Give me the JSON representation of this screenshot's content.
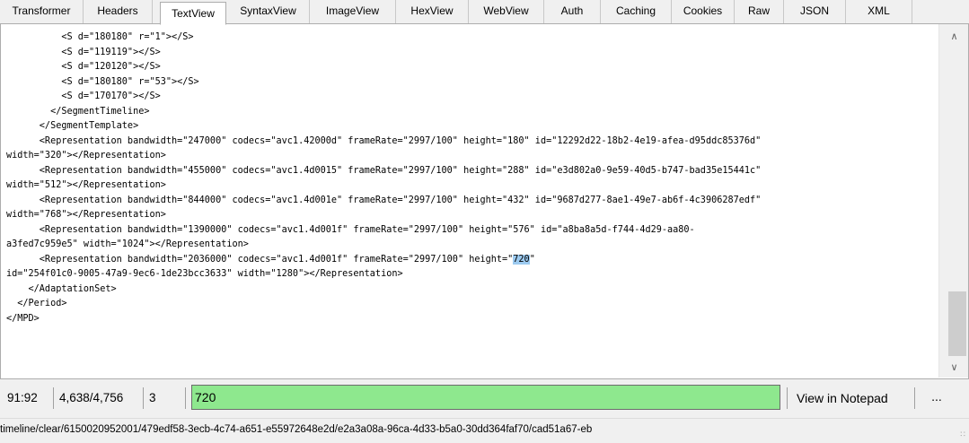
{
  "tabs": [
    {
      "label": "Transformer",
      "active": false
    },
    {
      "label": "Headers",
      "active": false
    },
    {
      "label": "TextView",
      "active": true
    },
    {
      "label": "SyntaxView",
      "active": false
    },
    {
      "label": "ImageView",
      "active": false
    },
    {
      "label": "HexView",
      "active": false
    },
    {
      "label": "WebView",
      "active": false
    },
    {
      "label": "Auth",
      "active": false
    },
    {
      "label": "Caching",
      "active": false
    },
    {
      "label": "Cookies",
      "active": false
    },
    {
      "label": "Raw",
      "active": false
    },
    {
      "label": "JSON",
      "active": false
    },
    {
      "label": "XML",
      "active": false
    }
  ],
  "text_lines": [
    "          <S d=\"180180\" r=\"1\"></S>",
    "          <S d=\"119119\"></S>",
    "          <S d=\"120120\"></S>",
    "          <S d=\"180180\" r=\"53\"></S>",
    "          <S d=\"170170\"></S>",
    "        </SegmentTimeline>",
    "      </SegmentTemplate>",
    "      <Representation bandwidth=\"247000\" codecs=\"avc1.42000d\" frameRate=\"2997/100\" height=\"180\" id=\"12292d22-18b2-4e19-afea-d95ddc85376d\"",
    "width=\"320\"></Representation>",
    "      <Representation bandwidth=\"455000\" codecs=\"avc1.4d0015\" frameRate=\"2997/100\" height=\"288\" id=\"e3d802a0-9e59-40d5-b747-bad35e15441c\"",
    "width=\"512\"></Representation>",
    "      <Representation bandwidth=\"844000\" codecs=\"avc1.4d001e\" frameRate=\"2997/100\" height=\"432\" id=\"9687d277-8ae1-49e7-ab6f-4c3906287edf\"",
    "width=\"768\"></Representation>",
    "      <Representation bandwidth=\"1390000\" codecs=\"avc1.4d001f\" frameRate=\"2997/100\" height=\"576\" id=\"a8ba8a5d-f744-4d29-aa80-",
    "a3fed7c959e5\" width=\"1024\"></Representation>",
    "      <Representation bandwidth=\"2036000\" codecs=\"avc1.4d001f\" frameRate=\"2997/100\" height=\"",
    "id=\"254f01c0-9005-47a9-9ec6-1de23bcc3633\" width=\"1280\"></Representation>",
    "    </AdaptationSet>",
    "  </Period>",
    "</MPD>"
  ],
  "highlight": {
    "text": "720",
    "suffix": "\""
  },
  "status": {
    "line_col": "91:92",
    "position": "4,638/4,756",
    "selection": "3"
  },
  "find": {
    "value": "720"
  },
  "buttons": {
    "view_in_notepad": "View in Notepad",
    "more": "..."
  },
  "url": "timeline/clear/6150020952001/479edf58-3ecb-4c74-a651-e55972648e2d/e2a3a08a-96ca-4d33-b5a0-30dd364faf70/cad51a67-eb",
  "colors": {
    "find_background": "#8ee88e",
    "highlight": "#9ccaf0"
  }
}
